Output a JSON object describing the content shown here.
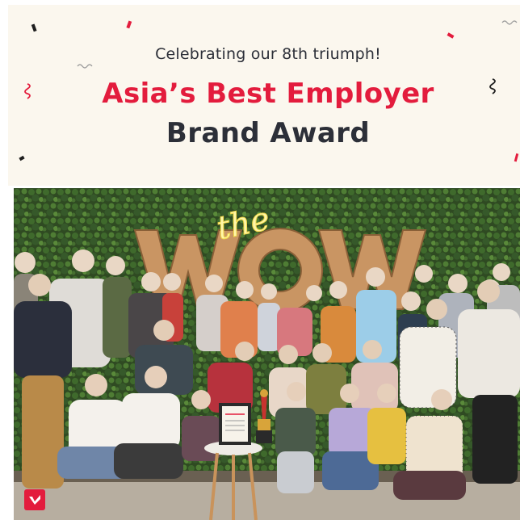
{
  "banner": {
    "subtitle": "Celebrating our 8th triumph!",
    "title_line1": "Asia’s Best Employer",
    "title_line2": "Brand Award",
    "accent_color": "#e31c3d",
    "text_color": "#2c2f38",
    "background_color": "#fbf7ee"
  },
  "photo": {
    "wall_sign_script": "the",
    "wall_sign_letters": "WOW",
    "plaque_icon": "trophy-icon"
  },
  "logo": {
    "icon": "brand-logo-icon",
    "color": "#e31c3d"
  }
}
